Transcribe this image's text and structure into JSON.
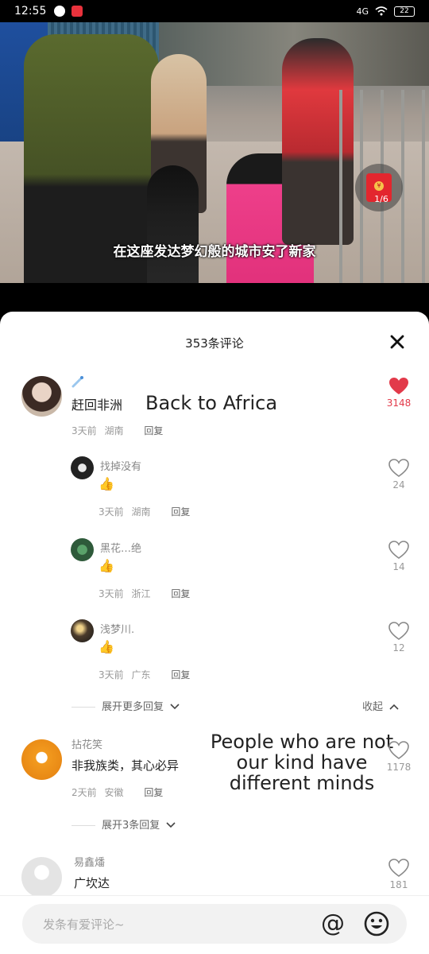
{
  "status_bar": {
    "time": "12:55",
    "network": "4G",
    "battery": "22"
  },
  "video": {
    "subtitle": "在这座发达梦幻般的城市安了新家",
    "red_packet_count": "1/6"
  },
  "sheet": {
    "title": "353条评论"
  },
  "comments": [
    {
      "name": "",
      "text": "赶回非洲",
      "overlay": "Back to Africa",
      "time": "3天前",
      "location": "湖南",
      "reply_label": "回复",
      "likes": "3148",
      "liked": true,
      "replies": [
        {
          "name": "找掉没有",
          "time": "3天前",
          "location": "湖南",
          "reply_label": "回复",
          "likes": "24"
        },
        {
          "name": "黑花…绝",
          "time": "3天前",
          "location": "浙江",
          "reply_label": "回复",
          "likes": "14"
        },
        {
          "name": "浅梦川.",
          "time": "3天前",
          "location": "广东",
          "reply_label": "回复",
          "likes": "12"
        }
      ],
      "expand_label": "展开更多回复",
      "collapse_label": "收起"
    },
    {
      "name": "拈花笑",
      "text": "非我族类，其心必异",
      "overlay_lines": [
        "People who are not",
        "our kind have",
        "different minds"
      ],
      "time": "2天前",
      "location": "安徽",
      "reply_label": "回复",
      "likes": "1178",
      "expand_label": "展开3条回复"
    },
    {
      "name": "易鑫燔",
      "text": "广坎达",
      "likes": "181"
    }
  ],
  "input": {
    "placeholder": "发条有爱评论~",
    "at_symbol": "@"
  },
  "colors": {
    "like_red": "#e23a4a",
    "red_packet": "#e3262e"
  },
  "icons": [
    "heart-icon",
    "close-icon",
    "chevron-down-icon",
    "chevron-up-icon",
    "emoji-icon",
    "at-icon",
    "red-packet-icon"
  ]
}
